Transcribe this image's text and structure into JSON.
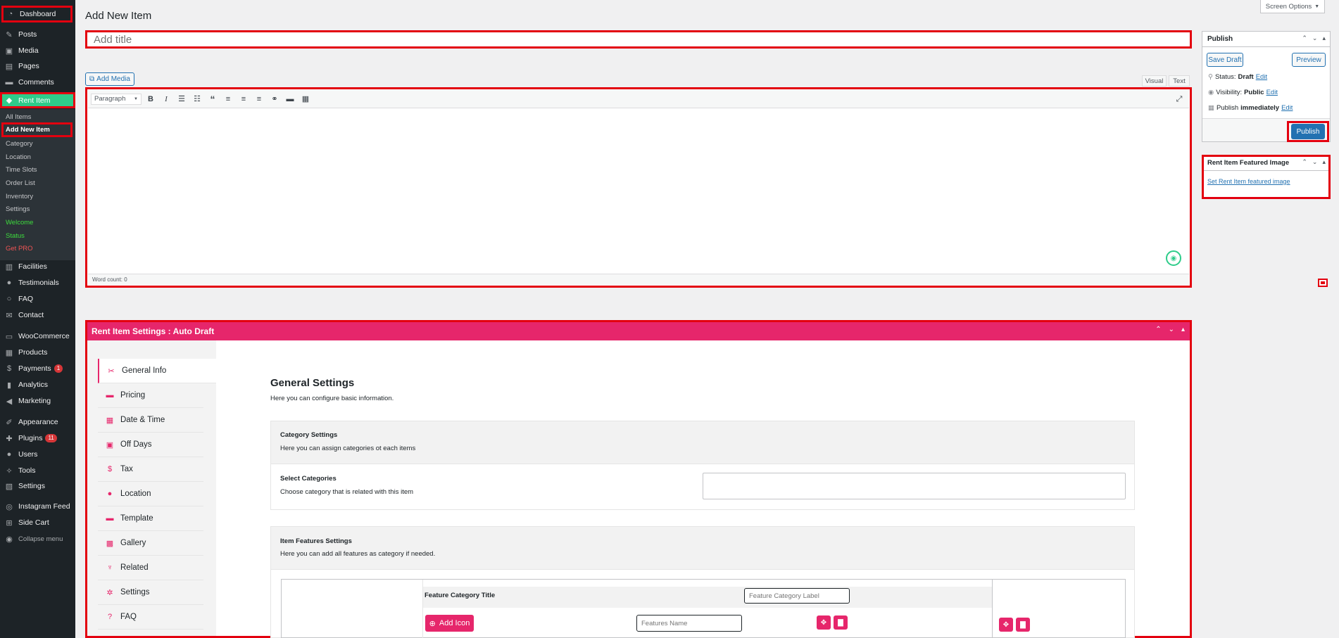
{
  "sidebar": {
    "top": {
      "dashboard": "Dashboard",
      "posts": "Posts",
      "media": "Media",
      "pages": "Pages",
      "comments": "Comments",
      "rent_item": "Rent Item"
    },
    "sub": {
      "all_items": "All Items",
      "add_new_item": "Add New Item",
      "category": "Category",
      "location": "Location",
      "time_slots": "Time Slots",
      "order_list": "Order List",
      "inventory": "Inventory",
      "settings": "Settings",
      "welcome": "Welcome",
      "status": "Status",
      "get_pro": "Get PRO"
    },
    "mid": {
      "facilities": "Facilities",
      "testimonials": "Testimonials",
      "faq": "FAQ",
      "contact": "Contact",
      "woocommerce": "WooCommerce",
      "products": "Products",
      "payments": "Payments",
      "payments_badge": "1",
      "analytics": "Analytics",
      "marketing": "Marketing",
      "appearance": "Appearance",
      "plugins": "Plugins",
      "plugins_badge": "11",
      "users": "Users",
      "tools": "Tools",
      "settings": "Settings",
      "instagram_feed": "Instagram Feed",
      "side_cart": "Side Cart",
      "collapse": "Collapse menu"
    }
  },
  "header": {
    "page_title": "Add New Item",
    "screen_options": "Screen Options"
  },
  "title_input": {
    "placeholder": "Add title"
  },
  "editor": {
    "add_media": "Add Media",
    "tab_visual": "Visual",
    "tab_text": "Text",
    "format": "Paragraph",
    "word_count": "Word count: 0"
  },
  "publish": {
    "title": "Publish",
    "save_draft": "Save Draft",
    "preview": "Preview",
    "status_label": "Status:",
    "status_value": "Draft",
    "visibility_label": "Visibility:",
    "visibility_value": "Public",
    "publish_label": "Publish",
    "publish_value": "immediately",
    "edit": "Edit",
    "publish_button": "Publish"
  },
  "featured": {
    "title": "Rent Item Featured Image",
    "link": "Set Rent Item featured image"
  },
  "settings_panel": {
    "title": "Rent Item Settings : Auto Draft",
    "tabs": [
      "General Info",
      "Pricing",
      "Date & Time",
      "Off Days",
      "Tax",
      "Location",
      "Template",
      "Gallery",
      "Related",
      "Settings",
      "FAQ"
    ],
    "general_title": "General Settings",
    "general_desc": "Here you can configure basic information.",
    "cat_settings_title": "Category Settings",
    "cat_settings_desc": "Here you can assign categories ot each items",
    "select_cat_title": "Select Categories",
    "select_cat_desc": "Choose category that is related with this item",
    "features_title": "Item Features Settings",
    "features_desc": "Here you can add all features as category if needed.",
    "feature_cat_title": "Feature Category Title",
    "feature_cat_placeholder": "Feature Category Label",
    "add_icon": "Add Icon",
    "features_name_placeholder": "Features Name"
  },
  "colors": {
    "accent": "#e6266b",
    "wp_blue": "#2271b1",
    "rent_item_green": "#2ecc8a",
    "highlight": "#e3000f"
  }
}
